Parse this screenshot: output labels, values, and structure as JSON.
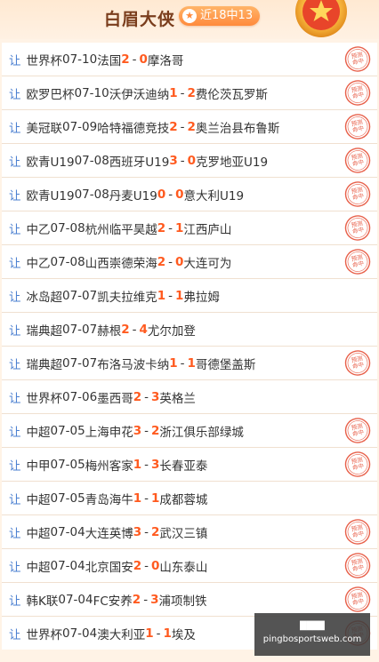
{
  "header": {
    "title": "白眉大侠",
    "record": "近18中13",
    "star_icon": "star-icon",
    "medal_icon": "medal-icon"
  },
  "rows": [
    {
      "rang": "让",
      "league": "世界杯",
      "date": "07-10",
      "home": "法国",
      "home_score": "2",
      "away_score": "0",
      "away": "摩洛哥",
      "stamp": "预测命中"
    },
    {
      "rang": "让",
      "league": "欧罗巴杯",
      "date": "07-10",
      "home": "沃伊沃迪纳",
      "home_score": "1",
      "away_score": "2",
      "away": "费伦茨瓦罗斯",
      "stamp": "预测命中"
    },
    {
      "rang": "让",
      "league": "美冠联",
      "date": "07-09",
      "home": "哈特福德竞技",
      "home_score": "2",
      "away_score": "2",
      "away": "奥兰治县布鲁斯",
      "stamp": "预测命中"
    },
    {
      "rang": "让",
      "league": "欧青U19",
      "date": "07-08",
      "home": "西班牙U19",
      "home_score": "3",
      "away_score": "0",
      "away": "克罗地亚U19",
      "stamp": "预测命中"
    },
    {
      "rang": "让",
      "league": "欧青U19",
      "date": "07-08",
      "home": "丹麦U19",
      "home_score": "0",
      "away_score": "0",
      "away": "意大利U19",
      "stamp": "预测命中"
    },
    {
      "rang": "让",
      "league": "中乙",
      "date": "07-08",
      "home": "杭州临平昊越",
      "home_score": "2",
      "away_score": "1",
      "away": "江西庐山",
      "stamp": "预测命中"
    },
    {
      "rang": "让",
      "league": "中乙",
      "date": "07-08",
      "home": "山西崇德荣海",
      "home_score": "2",
      "away_score": "0",
      "away": "大连可为",
      "stamp": "预测命中"
    },
    {
      "rang": "让",
      "league": "冰岛超",
      "date": "07-07",
      "home": "凯夫拉维克",
      "home_score": "1",
      "away_score": "1",
      "away": "弗拉姆",
      "stamp": ""
    },
    {
      "rang": "让",
      "league": "瑞典超",
      "date": "07-07",
      "home": "赫根",
      "home_score": "2",
      "away_score": "4",
      "away": "尤尔加登",
      "stamp": ""
    },
    {
      "rang": "让",
      "league": "瑞典超",
      "date": "07-07",
      "home": "布洛马波卡纳",
      "home_score": "1",
      "away_score": "1",
      "away": "哥德堡盖斯",
      "stamp": "预测命中"
    },
    {
      "rang": "让",
      "league": "世界杯",
      "date": "07-06",
      "home": "墨西哥",
      "home_score": "2",
      "away_score": "3",
      "away": "英格兰",
      "stamp": ""
    },
    {
      "rang": "让",
      "league": "中超",
      "date": "07-05",
      "home": "上海申花",
      "home_score": "3",
      "away_score": "2",
      "away": "浙江俱乐部绿城",
      "stamp": "预测命中"
    },
    {
      "rang": "让",
      "league": "中甲",
      "date": "07-05",
      "home": "梅州客家",
      "home_score": "1",
      "away_score": "3",
      "away": "长春亚泰",
      "stamp": "预测命中"
    },
    {
      "rang": "让",
      "league": "中超",
      "date": "07-05",
      "home": "青岛海牛",
      "home_score": "1",
      "away_score": "1",
      "away": "成都蓉城",
      "stamp": ""
    },
    {
      "rang": "让",
      "league": "中超",
      "date": "07-04",
      "home": "大连英博",
      "home_score": "3",
      "away_score": "2",
      "away": "武汉三镇",
      "stamp": "预测命中"
    },
    {
      "rang": "让",
      "league": "中超",
      "date": "07-04",
      "home": "北京国安",
      "home_score": "2",
      "away_score": "0",
      "away": "山东泰山",
      "stamp": "预测命中"
    },
    {
      "rang": "让",
      "league": "韩K联",
      "date": "07-04",
      "home": "FC安养",
      "home_score": "2",
      "away_score": "3",
      "away": "浦项制铁",
      "stamp": "预测命中"
    },
    {
      "rang": "让",
      "league": "世界杯",
      "date": "07-04",
      "home": "澳大利亚",
      "home_score": "1",
      "away_score": "1",
      "away": "埃及",
      "stamp": "预测命中"
    }
  ],
  "watermark": {
    "line1": "████",
    "line2": "pingbosportsweb.com"
  },
  "colors": {
    "accent": "#ff5a1f",
    "rang": "#4a7fd0",
    "stamp": "#e8604a",
    "title": "#7a3d1c"
  }
}
